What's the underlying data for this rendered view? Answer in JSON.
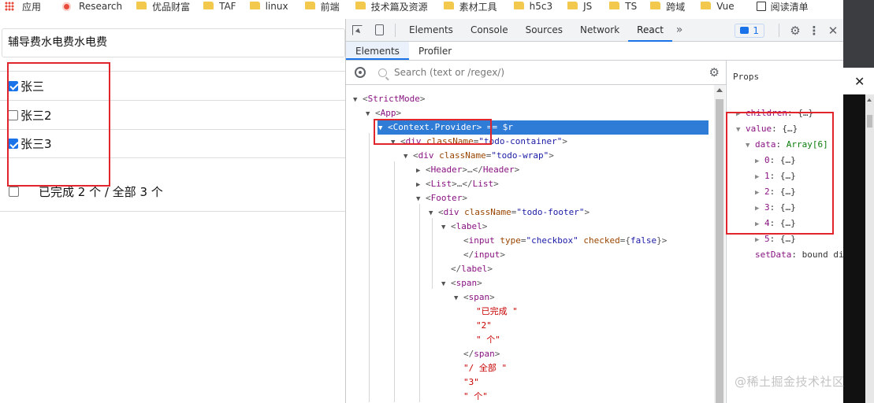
{
  "bookmarks": [
    {
      "label": "应用",
      "icon": "apps-grid-icon"
    },
    {
      "label": "Research",
      "icon": "research-icon"
    },
    {
      "label": "优品财富",
      "icon": "folder-icon"
    },
    {
      "label": "TAF",
      "icon": "folder-icon"
    },
    {
      "label": "linux",
      "icon": "folder-icon"
    },
    {
      "label": "前端",
      "icon": "folder-icon"
    },
    {
      "label": "技术篇及资源",
      "icon": "folder-icon"
    },
    {
      "label": "素材工具",
      "icon": "folder-icon"
    },
    {
      "label": "h5c3",
      "icon": "folder-icon"
    },
    {
      "label": "JS",
      "icon": "folder-icon"
    },
    {
      "label": "TS",
      "icon": "folder-icon"
    },
    {
      "label": "跨域",
      "icon": "folder-icon"
    },
    {
      "label": "Vue",
      "icon": "folder-icon"
    },
    {
      "label": "阅读清单",
      "icon": "reading-list-icon"
    }
  ],
  "app": {
    "header_value": "辅导费水电费水电费",
    "todos": [
      {
        "label": "张三",
        "done": true
      },
      {
        "label": "张三2",
        "done": false
      },
      {
        "label": "张三3",
        "done": true
      }
    ],
    "footer": {
      "text": "已完成 2 个 / 全部 3 个",
      "checked": false
    }
  },
  "devtools": {
    "tabs": [
      "Elements",
      "Console",
      "Sources",
      "Network",
      "React"
    ],
    "active_tab": "React",
    "more": "»",
    "message_count": "1",
    "subtabs": [
      "Elements",
      "Profiler"
    ],
    "active_subtab": "Elements",
    "search_placeholder": "Search (text or /regex/)",
    "tree": [
      {
        "indent": 0,
        "arrow": "▼",
        "parts": [
          [
            "sym",
            "<"
          ],
          [
            "tag",
            "StrictMode"
          ],
          [
            "sym",
            ">"
          ]
        ]
      },
      {
        "indent": 1,
        "arrow": "▼",
        "parts": [
          [
            "sym",
            "<"
          ],
          [
            "tag",
            "App"
          ],
          [
            "sym",
            ">"
          ]
        ]
      },
      {
        "indent": 2,
        "arrow": "▼",
        "selected": true,
        "parts": [
          [
            "sym",
            "<"
          ],
          [
            "tag",
            "Context.Provider"
          ],
          [
            "sym",
            "> == $r"
          ]
        ]
      },
      {
        "indent": 3,
        "arrow": "▼",
        "parts": [
          [
            "sym",
            "<"
          ],
          [
            "tag",
            "div "
          ],
          [
            "attr",
            "className"
          ],
          [
            "sym",
            "="
          ],
          [
            "val",
            "\"todo-container\""
          ],
          [
            "sym",
            ">"
          ]
        ]
      },
      {
        "indent": 4,
        "arrow": "▼",
        "parts": [
          [
            "sym",
            "<"
          ],
          [
            "tag",
            "div "
          ],
          [
            "attr",
            "className"
          ],
          [
            "sym",
            "="
          ],
          [
            "val",
            "\"todo-wrap\""
          ],
          [
            "sym",
            ">"
          ]
        ]
      },
      {
        "indent": 5,
        "arrow": "▶",
        "parts": [
          [
            "sym",
            "<"
          ],
          [
            "tag",
            "Header"
          ],
          [
            "sym",
            ">…</"
          ],
          [
            "tag",
            "Header"
          ],
          [
            "sym",
            ">"
          ]
        ]
      },
      {
        "indent": 5,
        "arrow": "▶",
        "parts": [
          [
            "sym",
            "<"
          ],
          [
            "tag",
            "List"
          ],
          [
            "sym",
            ">…</"
          ],
          [
            "tag",
            "List"
          ],
          [
            "sym",
            ">"
          ]
        ]
      },
      {
        "indent": 5,
        "arrow": "▼",
        "parts": [
          [
            "sym",
            "<"
          ],
          [
            "tag",
            "Footer"
          ],
          [
            "sym",
            ">"
          ]
        ]
      },
      {
        "indent": 6,
        "arrow": "▼",
        "parts": [
          [
            "sym",
            "<"
          ],
          [
            "tag",
            "div "
          ],
          [
            "attr",
            "className"
          ],
          [
            "sym",
            "="
          ],
          [
            "val",
            "\"todo-footer\""
          ],
          [
            "sym",
            ">"
          ]
        ]
      },
      {
        "indent": 7,
        "arrow": "▼",
        "parts": [
          [
            "sym",
            "<"
          ],
          [
            "tag",
            "label"
          ],
          [
            "sym",
            ">"
          ]
        ]
      },
      {
        "indent": 8,
        "arrow": "",
        "parts": [
          [
            "sym",
            "<"
          ],
          [
            "tag",
            "input "
          ],
          [
            "attr",
            "type"
          ],
          [
            "sym",
            "="
          ],
          [
            "val",
            "\"checkbox\""
          ],
          [
            "attr",
            " checked"
          ],
          [
            "sym",
            "={"
          ],
          [
            "val",
            "false"
          ],
          [
            "sym",
            "}>"
          ]
        ]
      },
      {
        "indent": 8,
        "arrow": "",
        "parts": [
          [
            "sym",
            "</"
          ],
          [
            "tag",
            "input"
          ],
          [
            "sym",
            ">"
          ]
        ]
      },
      {
        "indent": 7,
        "arrow": "",
        "parts": [
          [
            "sym",
            "</"
          ],
          [
            "tag",
            "label"
          ],
          [
            "sym",
            ">"
          ]
        ]
      },
      {
        "indent": 7,
        "arrow": "▼",
        "parts": [
          [
            "sym",
            "<"
          ],
          [
            "tag",
            "span"
          ],
          [
            "sym",
            ">"
          ]
        ]
      },
      {
        "indent": 8,
        "arrow": "▼",
        "parts": [
          [
            "sym",
            "<"
          ],
          [
            "tag",
            "span"
          ],
          [
            "sym",
            ">"
          ]
        ]
      },
      {
        "indent": 9,
        "arrow": "",
        "parts": [
          [
            "str",
            "\"已完成 \""
          ]
        ]
      },
      {
        "indent": 9,
        "arrow": "",
        "parts": [
          [
            "str",
            "\"2\""
          ]
        ]
      },
      {
        "indent": 9,
        "arrow": "",
        "parts": [
          [
            "str",
            "\" 个\""
          ]
        ]
      },
      {
        "indent": 8,
        "arrow": "",
        "parts": [
          [
            "sym",
            "</"
          ],
          [
            "tag",
            "span"
          ],
          [
            "sym",
            ">"
          ]
        ]
      },
      {
        "indent": 8,
        "arrow": "",
        "parts": [
          [
            "str",
            "\"/ 全部 \""
          ]
        ]
      },
      {
        "indent": 8,
        "arrow": "",
        "parts": [
          [
            "str",
            "\"3\""
          ]
        ]
      },
      {
        "indent": 8,
        "arrow": "",
        "parts": [
          [
            "str",
            "\" 个\""
          ]
        ]
      }
    ],
    "props": {
      "title": "Props",
      "rows": [
        {
          "indent": 0,
          "arrow": "▶",
          "key": "children",
          "value": "{…}"
        },
        {
          "indent": 0,
          "arrow": "▼",
          "key": "value",
          "value": "{…}"
        },
        {
          "indent": 1,
          "arrow": "▼",
          "key": "data",
          "value": "Array[6]",
          "type": true
        },
        {
          "indent": 2,
          "arrow": "▶",
          "key": "0",
          "value": "{…}"
        },
        {
          "indent": 2,
          "arrow": "▶",
          "key": "1",
          "value": "{…}"
        },
        {
          "indent": 2,
          "arrow": "▶",
          "key": "2",
          "value": "{…}"
        },
        {
          "indent": 2,
          "arrow": "▶",
          "key": "3",
          "value": "{…}"
        },
        {
          "indent": 2,
          "arrow": "▶",
          "key": "4",
          "value": "{…}"
        },
        {
          "indent": 2,
          "arrow": "▶",
          "key": "5",
          "value": "{…}"
        },
        {
          "indent": 1,
          "arrow": "",
          "key": "setData",
          "value": "bound dis"
        }
      ]
    }
  },
  "watermark": "@稀土掘金技术社区",
  "colors": {
    "highlight": "#e0262c",
    "selection": "#2f7cd7",
    "accent": "#1a73e8"
  }
}
